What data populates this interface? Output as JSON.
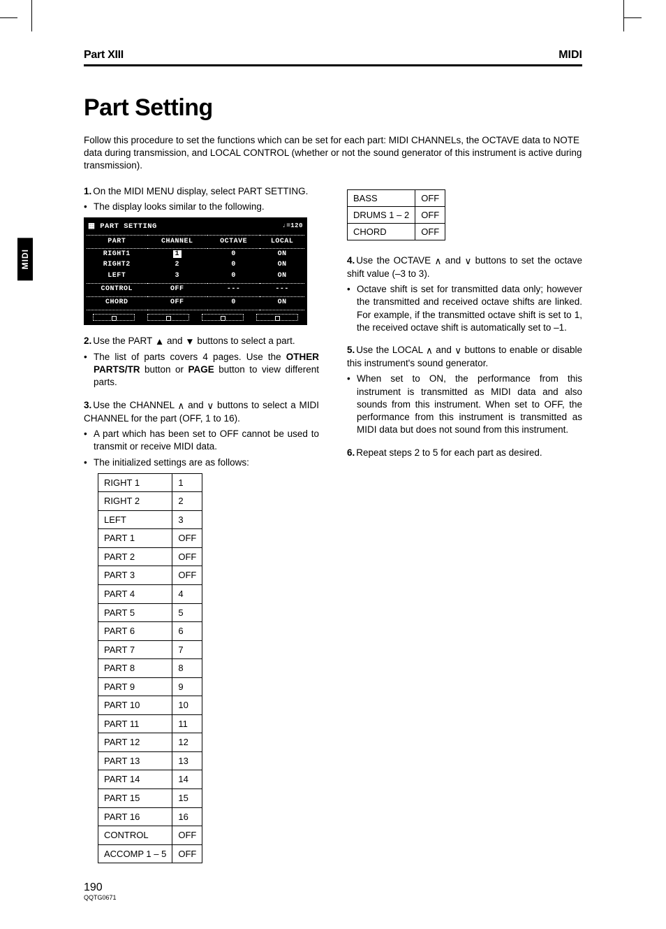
{
  "header": {
    "left": "Part XIII",
    "right": "MIDI"
  },
  "side_tab": "MIDI",
  "title": "Part Setting",
  "intro": "Follow this procedure to set the functions which can be set for each part: MIDI CHANNELs, the OCTAVE data to NOTE data during transmission, and LOCAL CONTROL (whether or not the sound generator of this instrument is active during transmission).",
  "lcd": {
    "title": "PART SETTING",
    "tempo": "♩=120",
    "cols": [
      "PART",
      "CHANNEL",
      "OCTAVE",
      "LOCAL"
    ],
    "rows": [
      [
        "RIGHT1",
        "1",
        "0",
        "ON"
      ],
      [
        "RIGHT2",
        "2",
        "0",
        "ON"
      ],
      [
        "LEFT",
        "3",
        "0",
        "ON"
      ]
    ],
    "rows2": [
      [
        "CONTROL",
        "OFF",
        "---",
        "---"
      ]
    ],
    "rows3": [
      [
        "CHORD",
        "OFF",
        "0",
        "ON"
      ]
    ]
  },
  "step1": {
    "text": "On the MIDI MENU display, select PART SETTING.",
    "bullet": "The display looks similar to the following."
  },
  "step2": {
    "text_a": "Use the PART ",
    "text_b": " and ",
    "text_c": " buttons to select a part.",
    "bullet_a": "The list of parts covers 4 pages. Use the ",
    "bold1": "OTHER PARTS/TR",
    "bullet_b": " button or ",
    "bold2": "PAGE",
    "bullet_c": " button to view different parts."
  },
  "step3": {
    "text_a": "Use the CHANNEL ",
    "text_b": " and ",
    "text_c": " buttons to select a MIDI CHANNEL for the part (OFF, 1 to 16).",
    "bullet1": "A part which has been set to OFF cannot be used to transmit or receive MIDI data.",
    "bullet2": "The initialized settings are as follows:"
  },
  "init_table": [
    [
      "RIGHT 1",
      "1"
    ],
    [
      "RIGHT 2",
      "2"
    ],
    [
      "LEFT",
      "3"
    ],
    [
      "PART 1",
      "OFF"
    ],
    [
      "PART 2",
      "OFF"
    ],
    [
      "PART 3",
      "OFF"
    ],
    [
      "PART 4",
      "4"
    ],
    [
      "PART 5",
      "5"
    ],
    [
      "PART 6",
      "6"
    ],
    [
      "PART 7",
      "7"
    ],
    [
      "PART 8",
      "8"
    ],
    [
      "PART 9",
      "9"
    ],
    [
      "PART 10",
      "10"
    ],
    [
      "PART 11",
      "11"
    ],
    [
      "PART 12",
      "12"
    ],
    [
      "PART 13",
      "13"
    ],
    [
      "PART 14",
      "14"
    ],
    [
      "PART 15",
      "15"
    ],
    [
      "PART 16",
      "16"
    ],
    [
      "CONTROL",
      "OFF"
    ],
    [
      "ACCOMP 1 – 5",
      "OFF"
    ]
  ],
  "extra_table": [
    [
      "BASS",
      "OFF"
    ],
    [
      "DRUMS 1 – 2",
      "OFF"
    ],
    [
      "CHORD",
      "OFF"
    ]
  ],
  "step4": {
    "text_a": "Use the OCTAVE ",
    "text_b": " and ",
    "text_c": " buttons to set the octave shift value (–3 to 3).",
    "bullet": "Octave shift is set for transmitted data only; however the transmitted and received octave shifts are linked. For example, if the transmitted octave shift is set to 1, the received octave shift is automatically set to –1."
  },
  "step5": {
    "text_a": "Use the LOCAL ",
    "text_b": " and ",
    "text_c": " buttons to enable or disable this instrument's sound generator.",
    "bullet": "When set to ON, the performance from this instrument is transmitted as MIDI data and also sounds from this instrument. When set to OFF, the performance from this instrument is transmitted as MIDI data but does not sound from this instrument."
  },
  "step6": {
    "text": "Repeat steps 2 to 5 for each part as desired."
  },
  "footer": {
    "page": "190",
    "code": "QQTG0671"
  },
  "glyph": {
    "tri_up": "▲",
    "tri_down": "▼",
    "and_up": "∧",
    "and_down": "∨"
  }
}
